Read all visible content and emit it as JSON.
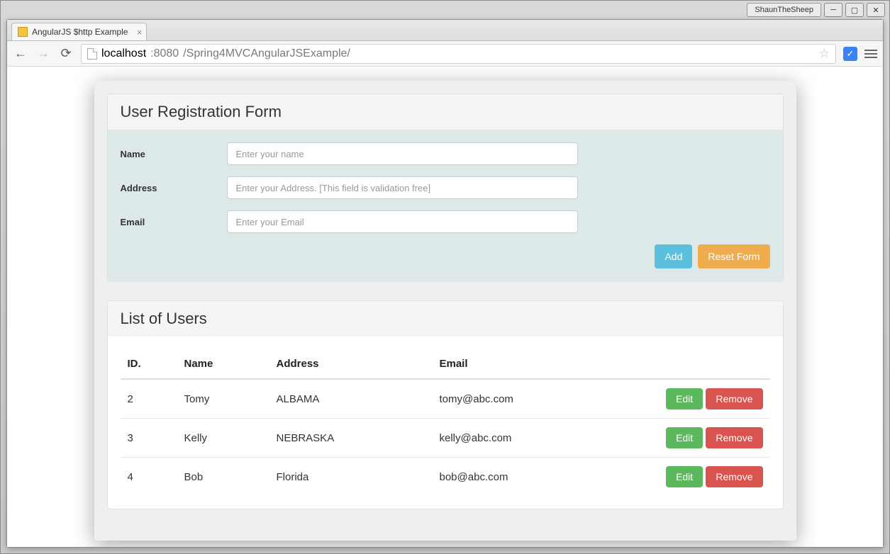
{
  "os": {
    "username": "ShaunTheSheep"
  },
  "browser": {
    "tab_title": "AngularJS $http Example",
    "url_host": "localhost",
    "url_port": ":8080",
    "url_path": "/Spring4MVCAngularJSExample/"
  },
  "form": {
    "title": "User Registration Form",
    "name_label": "Name",
    "name_placeholder": "Enter your name",
    "address_label": "Address",
    "address_placeholder": "Enter your Address. [This field is validation free]",
    "email_label": "Email",
    "email_placeholder": "Enter your Email",
    "add_button": "Add",
    "reset_button": "Reset Form"
  },
  "table": {
    "title": "List of Users",
    "headers": {
      "id": "ID.",
      "name": "Name",
      "address": "Address",
      "email": "Email"
    },
    "edit_label": "Edit",
    "remove_label": "Remove",
    "rows": [
      {
        "id": "2",
        "name": "Tomy",
        "address": "ALBAMA",
        "email": "tomy@abc.com"
      },
      {
        "id": "3",
        "name": "Kelly",
        "address": "NEBRASKA",
        "email": "kelly@abc.com"
      },
      {
        "id": "4",
        "name": "Bob",
        "address": "Florida",
        "email": "bob@abc.com"
      }
    ]
  }
}
